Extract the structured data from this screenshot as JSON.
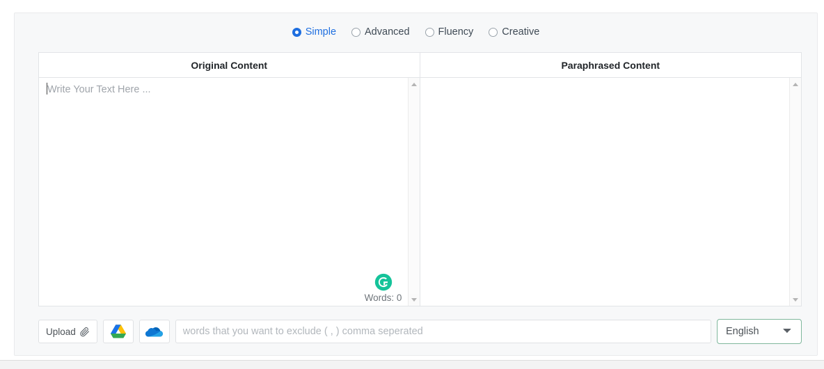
{
  "modes": [
    {
      "label": "Simple",
      "selected": true,
      "name": "mode-simple"
    },
    {
      "label": "Advanced",
      "selected": false,
      "name": "mode-advanced"
    },
    {
      "label": "Fluency",
      "selected": false,
      "name": "mode-fluency"
    },
    {
      "label": "Creative",
      "selected": false,
      "name": "mode-creative"
    }
  ],
  "panes": {
    "original": {
      "header": "Original Content",
      "placeholder": "Write Your Text Here ...",
      "value": "",
      "words_label": "Words: 0",
      "grammarly_icon": "grammarly-icon"
    },
    "paraphrased": {
      "header": "Paraphrased Content",
      "placeholder": "",
      "value": ""
    }
  },
  "toolbar": {
    "upload_label": "Upload",
    "upload_icon": "paperclip-icon",
    "google_drive_icon": "google-drive-icon",
    "onedrive_icon": "onedrive-icon",
    "exclude_placeholder": "words that you want to exclude ( , ) comma seperated",
    "exclude_value": "",
    "language_selected": "English",
    "language_options": [
      "English"
    ]
  },
  "colors": {
    "accent_blue": "#1f6fe0",
    "grammarly_green": "#15c39a",
    "select_border": "#7fb79c",
    "card_bg": "#f7f8f9",
    "text_muted": "#a0a5ab"
  }
}
